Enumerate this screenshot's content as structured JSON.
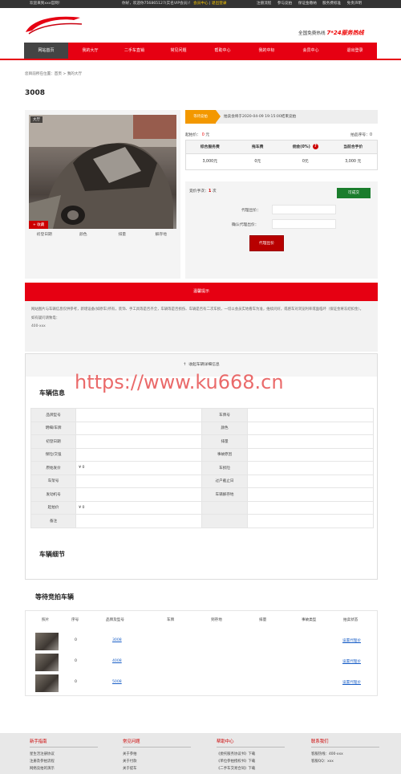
{
  "topbar": {
    "welcome": "欢迎来到xxx官网！",
    "user_greeting": "你好，欢迎你756865127(实名VIP会员)！",
    "member_center": "会员中心",
    "logout": "退出登录",
    "links": [
      "注册流程",
      "参与竞拍",
      "保证金缴纳",
      "服务费标准",
      "免责声明"
    ]
  },
  "header": {
    "hotline_label": "全国免费热线",
    "hotline_value": "7*24服务热线"
  },
  "nav": {
    "items": [
      "网站首页",
      "我的大厅",
      "二手车直销",
      "常见问题",
      "帮助中心",
      "我的中标",
      "会员中心",
      "退出登录"
    ],
    "active_index": 0
  },
  "breadcrumb": "您目前所在位置：首页 > 我的大厅",
  "page_title": "3008",
  "car": {
    "image_tag": "大厅",
    "favorite": "+ 收藏",
    "labels": [
      "初登日期",
      "颜色",
      "排量",
      "解存地"
    ]
  },
  "bid": {
    "status_badge": "等待竞拍",
    "status_text": "拍卖会将于2020-04-09 19:15:00结束竞拍",
    "start_price_label": "起拍价：",
    "start_price_value": "0",
    "start_price_unit": "元",
    "lot_no": "拍品序号：0",
    "fee_headers": [
      "综合服务费",
      "拖车费",
      "佣金(0%)",
      "当前合手价"
    ],
    "fee_values": [
      "3,000元",
      "0元",
      "0元",
      "3,000 元"
    ],
    "help_icon_glyph": "?"
  },
  "proxy": {
    "count_label": "竞价手次：",
    "count_value": "1",
    "count_unit": "次",
    "deal_button": "可成交",
    "price_label": "代理出价：",
    "confirm_label": "确认代理出价：",
    "submit_button": "代理出价"
  },
  "notice": {
    "title": "温馨提示",
    "text": "网站图片与车辆信息仅供参考，新增设备(如原车)所有，装饰、手工具等是否齐全，车辆等是否损伤、车辆是否有二次车损，一切以会员实地看车为准，维续问好，或感车对浏览利率或面临坏（保证金将冻结扣金）。",
    "phone_label": "如有疑问请致电：",
    "phone_value": "400-xxx"
  },
  "detail": {
    "toggle": "收起车辆详细信息",
    "info_title": "车辆信息",
    "detail_title": "车辆细节",
    "spec_rows": [
      {
        "k1": "品牌型号",
        "v1": "",
        "k2": "车牌号",
        "v2": ""
      },
      {
        "k1": "明细/车牌",
        "v1": "",
        "k2": "颜色",
        "v2": ""
      },
      {
        "k1": "初登日期",
        "v1": "",
        "k2": "排量",
        "v2": ""
      },
      {
        "k1": "保险/交强",
        "v1": "",
        "k2": "事故原因",
        "v2": ""
      },
      {
        "k1": "原始发价",
        "v1": "¥ 0",
        "k2": "车损险",
        "v2": ""
      },
      {
        "k1": "车架号",
        "v1": "",
        "k2": "过户截止日",
        "v2": ""
      },
      {
        "k1": "发动机号",
        "v1": "",
        "k2": "车辆解存地",
        "v2": ""
      },
      {
        "k1": "起拍价",
        "v1": "¥ 0",
        "k2": "",
        "v2": ""
      },
      {
        "k1": "备注",
        "v1": "",
        "k2": "",
        "v2": ""
      }
    ]
  },
  "watermark": "https://www.ku668.cn",
  "waiting": {
    "title": "等待竞拍车辆",
    "headers": [
      "照片",
      "序号",
      "品牌及型号",
      "车牌",
      "到存地",
      "排量",
      "事故类型",
      "拍卖状态"
    ],
    "rows": [
      {
        "seq": "0",
        "model": "3008",
        "action": "设置代理价"
      },
      {
        "seq": "0",
        "model": "4008",
        "action": "设置代理价"
      },
      {
        "seq": "0",
        "model": "5008",
        "action": "设置代理价"
      }
    ]
  },
  "footer": {
    "cols": [
      {
        "title": "新手指南",
        "items": [
          "星生活注册协议",
          "注册及参拍流程",
          "网络竞拍的演示"
        ]
      },
      {
        "title": "常见问题",
        "items": [
          "关于参拍",
          "关于付款",
          "关于提车"
        ]
      },
      {
        "title": "帮助中心",
        "items": [
          "《委托服务协议书》下载",
          "《单位参拍授权书》下载",
          "《二手车交易合同》下载"
        ]
      },
      {
        "title": "联系我们",
        "items": [
          "客服热线：400-xxx",
          "客服QQ：xxx"
        ]
      }
    ]
  },
  "colors": {
    "brand_red": "#e60012",
    "accent_orange": "#f39800",
    "deal_green": "#1a7d2c",
    "link_blue": "#1a5fc7"
  }
}
